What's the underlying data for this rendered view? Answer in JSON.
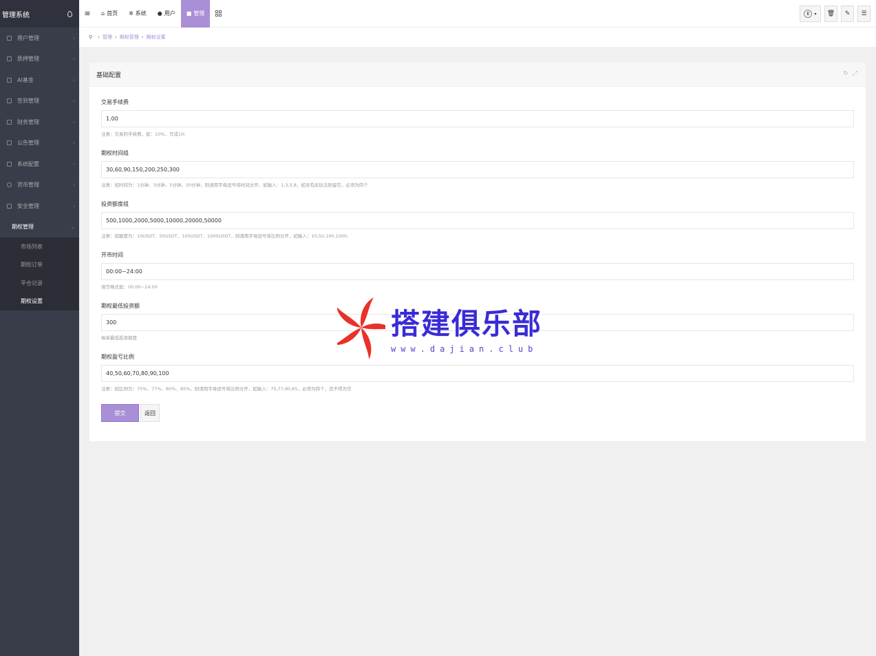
{
  "sidebar": {
    "brand": "管理系统",
    "items": [
      {
        "label": "用户管理",
        "icon": "user-icon"
      },
      {
        "label": "质押管理",
        "icon": "list-icon"
      },
      {
        "label": "AI基金",
        "icon": "monitor-icon"
      },
      {
        "label": "签到管理",
        "icon": "edit-icon"
      },
      {
        "label": "财务管理",
        "icon": "money-icon"
      },
      {
        "label": "公告管理",
        "icon": "list-icon"
      },
      {
        "label": "系统配置",
        "icon": "gears-icon"
      },
      {
        "label": "货币管理",
        "icon": "coin-icon"
      },
      {
        "label": "安全管理",
        "icon": "lock-icon"
      }
    ],
    "active_item": "期权管理",
    "sub_items": [
      "市场列表",
      "期权订单",
      "平仓记录",
      "期权设置"
    ]
  },
  "topbar": {
    "tabs": [
      {
        "label": "首页",
        "icon": "home-icon"
      },
      {
        "label": "系统",
        "icon": "gear-icon"
      },
      {
        "label": "用户",
        "icon": "user-icon"
      },
      {
        "label": "管理",
        "icon": "lock-icon"
      }
    ],
    "lang_glyph": "E"
  },
  "breadcrumb": [
    "管理",
    "期权管理",
    "期权设置"
  ],
  "card": {
    "title": "基础配置",
    "fields": [
      {
        "label": "交易手续费",
        "value": "1.00",
        "help": "注意：交易的手续费，如：10%，写成10;"
      },
      {
        "label": "期权时间组",
        "value": "30,60,90,150,200,250,300",
        "help": "注意：如时间为：1分钟、3分钟、5分钟、30分钟，则请用字母逗号将时间分开，如输入：1,3,5,8，如没有此玩法则留空，必须为四个"
      },
      {
        "label": "投资额度组",
        "value": "500,1000,2000,5000,10000,20000,50000",
        "help": "注意：如额度为：10USDT、50USDT、100USDT、1000USDT，则请用字母逗号将比例分开，如输入：10,50,100,1000,"
      },
      {
        "label": "开市时间",
        "value": "00:00~24:00",
        "help": "填写格式如：00:00~24:00"
      },
      {
        "label": "期权最低投资额",
        "value": "300",
        "help": "每单最低投资额度"
      },
      {
        "label": "期权盈亏比例",
        "value": "40,50,60,70,80,90,100",
        "help": "注意：如比例为：75%、77%、80%、85%，则请用字母逗号将比例分开，如输入：75,77,80,85，必须为四个，且不得为空"
      }
    ],
    "submit_label": "提交",
    "back_label": "返回"
  },
  "watermark": {
    "title": "搭建俱乐部",
    "url": "www.dajian.club"
  },
  "colors": {
    "sidebar_bg": "#393d49",
    "accent": "#a98fd6",
    "watermark_red": "#e8312a",
    "watermark_blue": "#3a2bd6"
  }
}
